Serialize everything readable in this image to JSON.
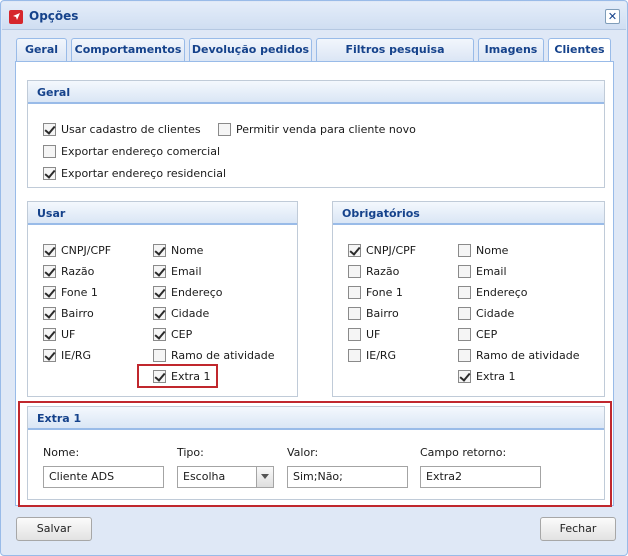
{
  "window": {
    "title": "Opções",
    "close_symbol": "✕"
  },
  "tabs": [
    {
      "label": "Geral"
    },
    {
      "label": "Comportamentos"
    },
    {
      "label": "Devolução pedidos"
    },
    {
      "label": "Filtros pesquisa produtos"
    },
    {
      "label": "Imagens"
    },
    {
      "label": "Clientes",
      "active": true
    }
  ],
  "geral": {
    "title": "Geral",
    "options": [
      {
        "label": "Usar cadastro de clientes",
        "checked": true
      },
      {
        "label": "Permitir venda para cliente novo",
        "checked": false
      },
      {
        "label": "Exportar endereço comercial",
        "checked": false
      },
      {
        "label": "Exportar endereço residencial",
        "checked": true
      }
    ]
  },
  "usar": {
    "title": "Usar",
    "col1": [
      {
        "label": "CNPJ/CPF",
        "checked": true
      },
      {
        "label": "Razão",
        "checked": true
      },
      {
        "label": "Fone 1",
        "checked": true
      },
      {
        "label": "Bairro",
        "checked": true
      },
      {
        "label": "UF",
        "checked": true
      },
      {
        "label": "IE/RG",
        "checked": true
      }
    ],
    "col2": [
      {
        "label": "Nome",
        "checked": true
      },
      {
        "label": "Email",
        "checked": true
      },
      {
        "label": "Endereço",
        "checked": true
      },
      {
        "label": "Cidade",
        "checked": true
      },
      {
        "label": "CEP",
        "checked": true
      },
      {
        "label": "Ramo de atividade",
        "checked": false
      },
      {
        "label": "Extra 1",
        "checked": true
      }
    ]
  },
  "obrigatorios": {
    "title": "Obrigatórios",
    "col1": [
      {
        "label": "CNPJ/CPF",
        "checked": true
      },
      {
        "label": "Razão",
        "checked": false
      },
      {
        "label": "Fone 1",
        "checked": false
      },
      {
        "label": "Bairro",
        "checked": false
      },
      {
        "label": "UF",
        "checked": false
      },
      {
        "label": "IE/RG",
        "checked": false
      }
    ],
    "col2": [
      {
        "label": "Nome",
        "checked": false
      },
      {
        "label": "Email",
        "checked": false
      },
      {
        "label": "Endereço",
        "checked": false
      },
      {
        "label": "Cidade",
        "checked": false
      },
      {
        "label": "CEP",
        "checked": false
      },
      {
        "label": "Ramo de atividade",
        "checked": false
      },
      {
        "label": "Extra 1",
        "checked": true
      }
    ]
  },
  "extra1": {
    "title": "Extra 1",
    "nome_label": "Nome:",
    "nome_value": "Cliente ADS",
    "tipo_label": "Tipo:",
    "tipo_value": "Escolha",
    "valor_label": "Valor:",
    "valor_value": "Sim;Não;",
    "campo_label": "Campo retorno:",
    "campo_value": "Extra2"
  },
  "buttons": {
    "save": "Salvar",
    "close": "Fechar"
  },
  "colors": {
    "highlight": "#c0272d",
    "title_blue": "#15428b",
    "app_icon_red": "#d6262c"
  }
}
